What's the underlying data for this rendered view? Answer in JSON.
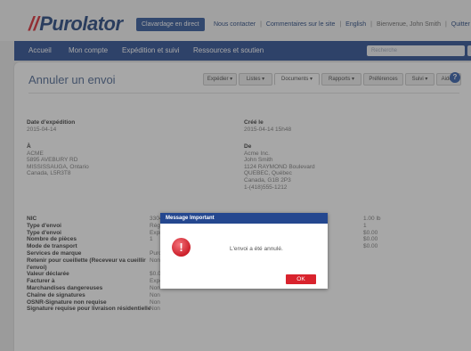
{
  "header": {
    "logo": "Purolator",
    "chat_button": "Clavardage en direct",
    "links": [
      "Nous contacter",
      "Commentaires sur le site",
      "English"
    ],
    "greeting": "Bienvenue, John Smith",
    "logout": "Quitter"
  },
  "nav": {
    "items": [
      "Accueil",
      "Mon compte",
      "Expédition et suivi",
      "Ressources et soutien"
    ],
    "search_placeholder": "Recherche"
  },
  "page": {
    "title": "Annuler un envoi",
    "tabs": [
      "Expédier ▾",
      "Listes ▾",
      "Documents ▾",
      "Rapports ▾",
      "Préférences",
      "Suivi ▾",
      "Aide ▾"
    ],
    "active_tab": "Documents ▾"
  },
  "shipment": {
    "date_label": "Date d’expédition",
    "date_value": "2015-04-14",
    "created_label": "Créé le",
    "created_value": "2015-04-14 15h48",
    "to_label": "À",
    "to_lines": [
      "ACME",
      "5895 AVEBURY RD",
      "MISSISSAUGA, Ontario",
      "Canada, L5R3T8"
    ],
    "from_label": "De",
    "from_lines": [
      "Acme Inc.",
      "John Smith",
      "1124 RAYMOND Boulevard",
      "QUEBEC, Québec",
      "Canada, G1B 2P3",
      "1-(418)555-1212"
    ]
  },
  "details": [
    {
      "label": "NIC",
      "value": "3304",
      "right": "1.00 lb"
    },
    {
      "label": "Type d'envoi",
      "value": "Régu",
      "right": "1"
    },
    {
      "label": "Type d'envoi",
      "value": "Expr",
      "right": "$0.00"
    },
    {
      "label": "Nombre de pièces",
      "value": "1",
      "right": "$0.00"
    },
    {
      "label": "Mode de transport",
      "value": "",
      "right": "$0.00"
    },
    {
      "label": "Services de marque",
      "value": "Puro",
      "right": ""
    },
    {
      "label": "Retenir pour cueillette (Receveur va cueillir l'envoi)",
      "value": "Non",
      "right": ""
    },
    {
      "label": "Valeur déclarée",
      "value": "$0.00",
      "right": ""
    },
    {
      "label": "Facturer à",
      "value": "Expéditeur",
      "right": ""
    },
    {
      "label": "Marchandises dangereuses",
      "value": "Non",
      "right": ""
    },
    {
      "label": "Chaîne de signatures",
      "value": "Non",
      "right": ""
    },
    {
      "label": "OSNR-Signature non requise",
      "value": "Non",
      "right": ""
    },
    {
      "label": "Signature requise pour livraison résidentielle",
      "value": "Non",
      "right": ""
    }
  ],
  "modal": {
    "title": "Message Important",
    "message": "L'envoi a été annulé.",
    "ok": "OK",
    "icon": "alert-icon"
  },
  "colors": {
    "brand_blue": "#24478f",
    "brand_red": "#d9232d"
  }
}
